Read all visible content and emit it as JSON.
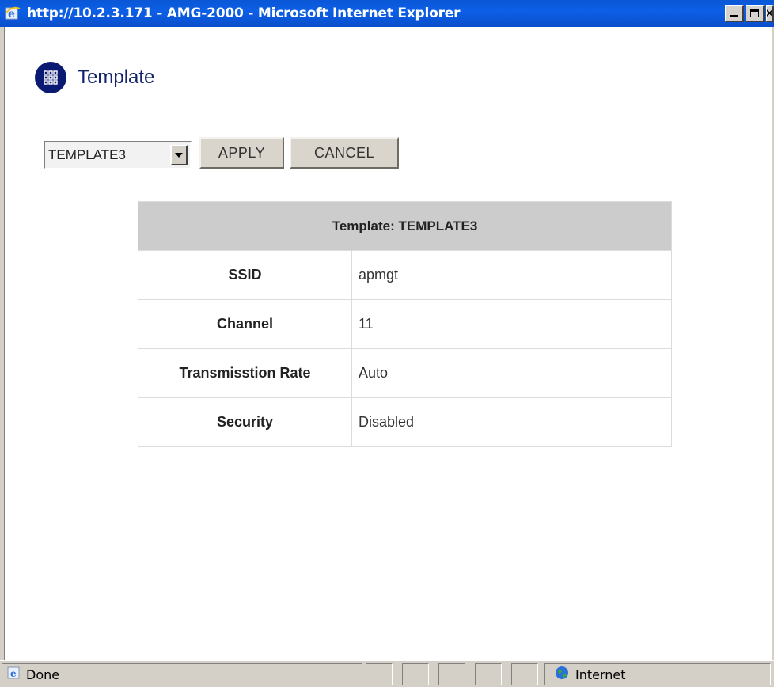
{
  "window": {
    "title": "http://10.2.3.171 - AMG-2000 - Microsoft Internet Explorer",
    "minimize_label": "_",
    "maximize_label": "□",
    "close_label": "×"
  },
  "page": {
    "heading": "Template",
    "heading_icon": "grid-icon"
  },
  "controls": {
    "template_select_value": "TEMPLATE3",
    "apply_label": "APPLY",
    "cancel_label": "CANCEL"
  },
  "table": {
    "header": "Template: TEMPLATE3",
    "rows": [
      {
        "label": "SSID",
        "value": "apmgt"
      },
      {
        "label": "Channel",
        "value": "11"
      },
      {
        "label": "Transmisstion Rate",
        "value": "Auto"
      },
      {
        "label": "Security",
        "value": "Disabled"
      }
    ]
  },
  "statusbar": {
    "status_text": "Done",
    "zone_text": "Internet"
  },
  "colors": {
    "titlebar": "#0a57d6",
    "heading_text": "#13246c",
    "heading_circle": "#0a1a72",
    "table_header_bg": "#cccccc"
  }
}
